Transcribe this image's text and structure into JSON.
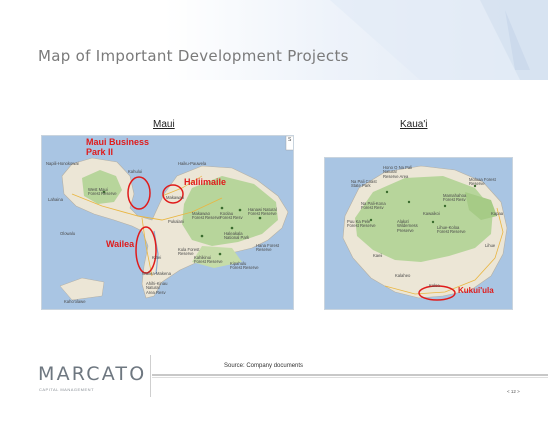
{
  "slide": {
    "title": "Map of Important Development Projects",
    "source": "Source: Company documents",
    "page_number": "< 12 >"
  },
  "logo": {
    "name": "MARCATO",
    "subtitle": "CAPITAL MANAGEMENT"
  },
  "maui": {
    "heading": "Maui",
    "scale_mark": "S",
    "projects": [
      {
        "label": "Maui Business Park II"
      },
      {
        "label": "Haliimaile"
      },
      {
        "label": "Wailea"
      }
    ],
    "map_labels": {
      "nanu": "Napili-Honokowai",
      "lahaina": "Lahaina",
      "west_maui": "West Maui\nForest Reserve",
      "kahului": "Kahului",
      "haiku": "Haiku-Pauwela",
      "makawao": "Makawao",
      "pukalani": "Pukalani",
      "makawao_fr": "Makawao\nForest Reserve",
      "koolau": "Koolau\nForest Resv",
      "hanawi": "Hanawi Natural\nForest Reserve",
      "haleakala": "Haleakala\nNational Park",
      "kula": "Kula Forest\nReserve",
      "kahikinui": "Kahikinui\nForest Reserve",
      "kipahulu": "Kipahulu\nForest Reserve",
      "hana": "Hana Forest\nReserve",
      "makena": "Wailea-Makena",
      "ahihi": "Ahihi-Kinau\nNatural\nArea Resv",
      "kaho": "Kaho'olawe",
      "kihei": "Kihei",
      "olowalu": "Olowalu"
    }
  },
  "kauai": {
    "heading": "Kaua'i",
    "projects": [
      {
        "label": "Kukui'ula"
      }
    ],
    "map_labels": {
      "hono": "Hono O Na Pali\nNatural\nReserve Area",
      "napali": "Na Pali Coast\nState Park",
      "moloaa": "Moloaa Forest\nReserve",
      "napalikona": "Na Pali-Kona\nForest Resv",
      "mamahahoa": "Mamahahoa\nForest Resv",
      "kawaikoi": "Kawaikoi",
      "kapaa": "Kapaa",
      "puu": "Puu Ka Pele\nForest Reserve",
      "alakai": "Alaka'i\nWilderness\nPreserve",
      "lihue_koloa": "Lihue-Koloa\nForest Reserve",
      "lihue": "Lihue",
      "kalaheo": "Kalaheo",
      "koloa": "Koloa",
      "kaeii": "Kaeii"
    }
  }
}
